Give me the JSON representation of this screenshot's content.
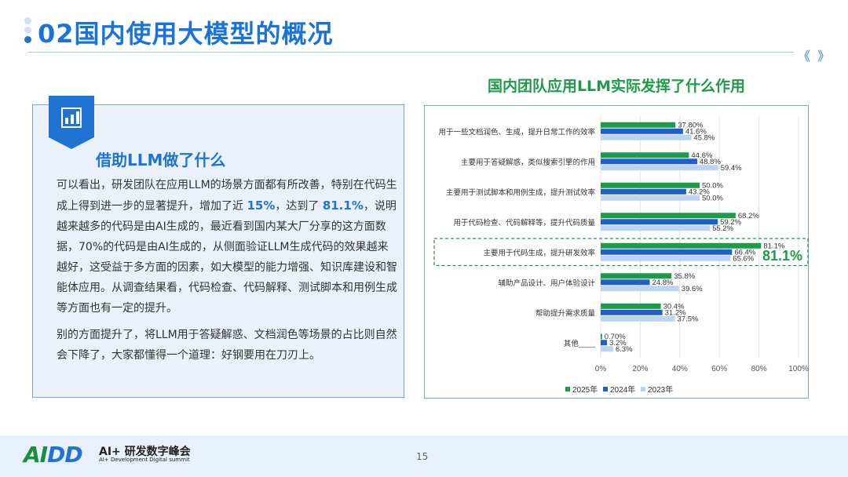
{
  "header": {
    "title": "02国内使用大模型的概况",
    "nav": "《 》"
  },
  "left": {
    "heading": "借助LLM做了什么",
    "p1_part1": "可以看出，研发团队在应用LLM的场景方面都有所改善，特别在代码生成上得到进一步的显著提升，增加了近 ",
    "p1_highlight1": "15%",
    "p1_part2": "，达到了 ",
    "p1_highlight2": "81.1%",
    "p1_part3": "，说明越来越多的代码是由AI生成的，最近看到国内某大厂分享的这方面数据，70%的代码是由AI生成的，从侧面验证LLM生成代码的效果越来越好，这受益于多方面的因素，如大模型的能力增强、知识库建设和智能体应用。从调查结果看，代码检查、代码解释、测试脚本和用例生成等方面也有一定的提升。",
    "p2": "别的方面提升了，将LLM用于答疑解惑、文档润色等场景的占比则自然会下降了，大家都懂得一个道理：好钢要用在刀刃上。"
  },
  "chart_data": {
    "type": "bar",
    "orientation": "horizontal",
    "title": "国内团队应用LLM实际发挥了什么作用",
    "categories": [
      "用于一些文档润色、生成，提升日常工作的效率",
      "主要用于答疑解惑，类似搜索引擎的作用",
      "主要用于测试脚本和用例生成，提升测试效率",
      "用于代码检查、代码解释等，提升代码质量",
      "主要用于代码生成，提升研发效率",
      "辅助产品设计、用户体验设计",
      "帮助提升需求质量",
      "其他____"
    ],
    "series": [
      {
        "name": "2025年",
        "color": "#1f9a4a",
        "values": [
          37.8,
          44.6,
          50.0,
          68.2,
          81.1,
          35.8,
          30.4,
          0.7
        ],
        "labels": [
          "37.80%",
          "44.6%",
          "50.0%",
          "68.2%",
          "81.1%",
          "35.8%",
          "30.4%",
          "0.70%"
        ]
      },
      {
        "name": "2024年",
        "color": "#1f5fc9",
        "values": [
          41.6,
          48.8,
          43.2,
          59.2,
          66.4,
          24.8,
          31.2,
          3.2
        ],
        "labels": [
          "41.6%",
          "48.8%",
          "43.2%",
          "59.2%",
          "66.4%",
          "24.8%",
          "31.2%",
          "3.2%"
        ]
      },
      {
        "name": "2023年",
        "color": "#bcd4f1",
        "values": [
          45.8,
          59.4,
          50.0,
          55.2,
          65.6,
          39.6,
          37.5,
          6.3
        ],
        "labels": [
          "45.8%",
          "59.4%",
          "50.0%",
          "55.2%",
          "65.6%",
          "39.6%",
          "37.5%",
          "6.3%"
        ]
      }
    ],
    "xlim": [
      0,
      100
    ],
    "xticks": [
      "0%",
      "20%",
      "40%",
      "60%",
      "80%",
      "100%"
    ],
    "grid": true,
    "legend": "bottom",
    "highlight": {
      "category_index": 4,
      "label": "81.1%"
    }
  },
  "footer": {
    "logo_mark_a": "AI",
    "logo_mark_b": "DD",
    "logo_line1": "AI+ 研发数字峰会",
    "logo_line2": "AI+ Development Digital summit",
    "page_number": "15"
  }
}
